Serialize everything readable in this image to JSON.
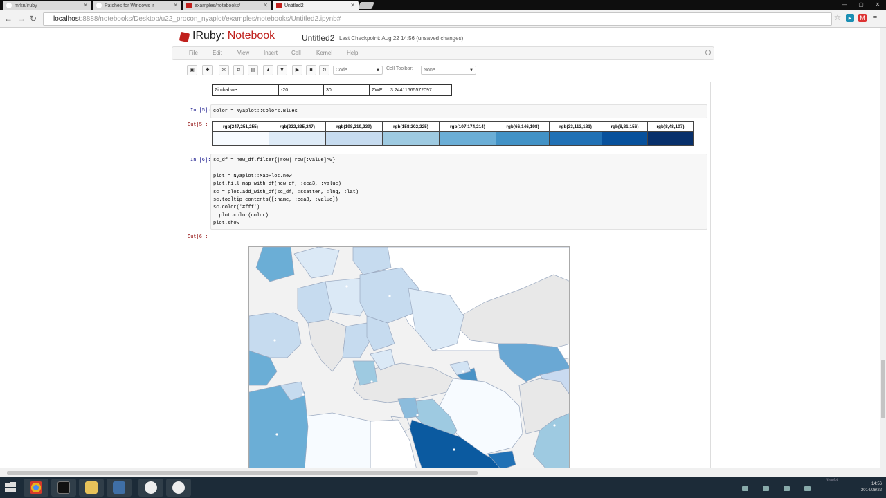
{
  "browser": {
    "tabs": [
      {
        "title": "mrkn/iruby",
        "icon": "github-icon"
      },
      {
        "title": "Patches for Windows ir",
        "icon": "github-icon"
      },
      {
        "title": "examples/notebooks/",
        "icon": "iruby-icon"
      },
      {
        "title": "Untitled2",
        "icon": "iruby-icon",
        "active": true
      }
    ],
    "url_host": "localhost",
    "url_rest": ":8888/notebooks/Desktop/u22_procon_nyaplot/examples/notebooks/Untitled2.ipynb#"
  },
  "header": {
    "logo_prefix": "IRuby: ",
    "logo_suffix": "Notebook",
    "notebook_name": "Untitled2",
    "checkpoint": "Last Checkpoint: Aug 22 14:56 (unsaved changes)"
  },
  "menu": [
    "File",
    "Edit",
    "View",
    "Insert",
    "Cell",
    "Kernel",
    "Help"
  ],
  "toolbar": {
    "cell_type": "Code",
    "cell_toolbar_label": "Cell Toolbar:",
    "cell_toolbar_value": "None"
  },
  "cells": {
    "prev_output_row": [
      "Zimbabwe",
      "-20",
      "30",
      "ZWE",
      "3.24411665572097"
    ],
    "in5_prompt": "In [5]:",
    "in5_code": "color = Nyaplot::Colors.Blues",
    "out5_prompt": "Out[5]:",
    "out5_colors": [
      "rgb(247,251,255)",
      "rgb(222,235,247)",
      "rgb(198,219,239)",
      "rgb(158,202,225)",
      "rgb(107,174,214)",
      "rgb(66,146,198)",
      "rgb(33,113,181)",
      "rgb(8,81,156)",
      "rgb(8,48,107)"
    ],
    "in6_prompt": "In [6]:",
    "in6_code": "sc_df = new_df.filter{|row| row[:value]>0}\n\nplot = Nyaplot::MapPlot.new\nplot.fill_map_with_df(new_df, :cca3, :value)\nsc = plot.add_with_df(sc_df, :scatter, :lng, :lat)\nsc.tooltip_contents([:name, :cca3, :value])\nsc.color('#fff')\n  plot.color(color)\nplot.show",
    "out6_prompt": "Out[6]:"
  },
  "taskbar": {
    "clock_time": "14:56",
    "clock_date": "2014/08/22",
    "notice": "Nyaplot"
  }
}
